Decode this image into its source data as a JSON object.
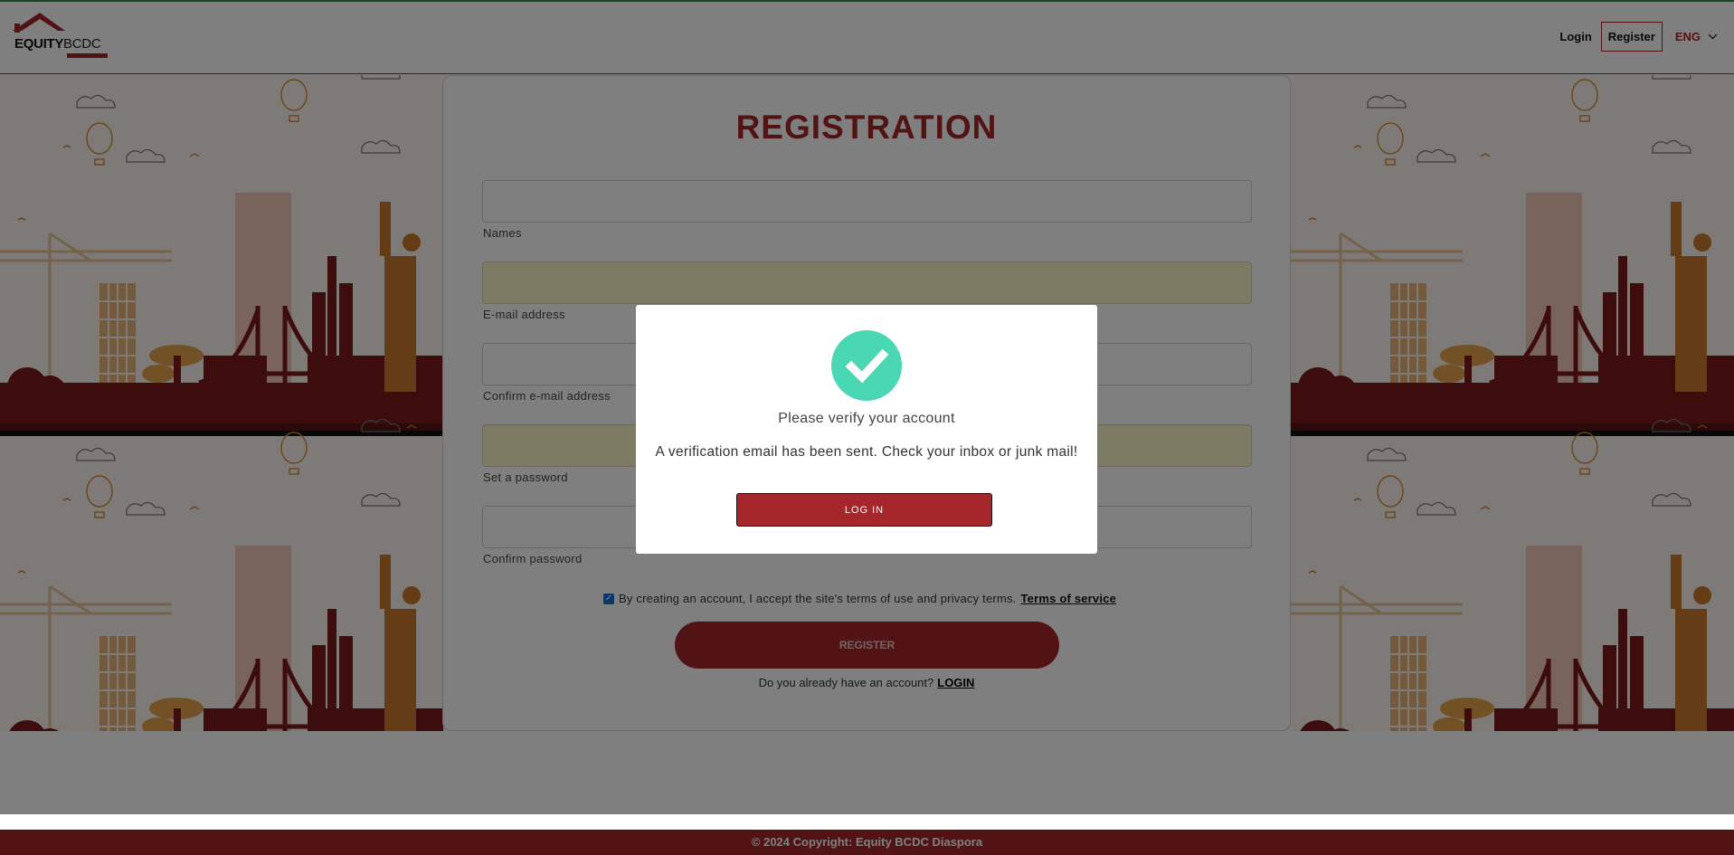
{
  "header": {
    "logo_text_bold": "EQUITY",
    "logo_text_light": "BCDC",
    "login_label": "Login",
    "register_label": "Register",
    "language_label": "ENG"
  },
  "form": {
    "title": "REGISTRATION",
    "fields": [
      {
        "label": "Names",
        "value": ""
      },
      {
        "label": "E-mail address",
        "value": ""
      },
      {
        "label": "Confirm e-mail address",
        "value": ""
      },
      {
        "label": "Set a password",
        "value": ""
      },
      {
        "label": "Confirm password",
        "value": ""
      }
    ],
    "terms_text": "By creating an account, I accept the site's terms of use and privacy terms.",
    "terms_link": "Terms of service",
    "terms_checked": true,
    "register_button": "REGISTER",
    "already_text": "Do you already have an account?",
    "login_link": "LOGIN"
  },
  "modal": {
    "title": "Please verify your account",
    "message": "A verification email has been sent. Check your inbox or junk mail!",
    "button_label": "LOG IN",
    "icon": "check-circle-icon",
    "icon_color": "#49d7b4"
  },
  "footer": {
    "copyright": "© 2024 Copyright: Equity BCDC Diaspora"
  },
  "colors": {
    "brand_red": "#a5262b",
    "autofill_yellow": "#fbf7c6"
  }
}
